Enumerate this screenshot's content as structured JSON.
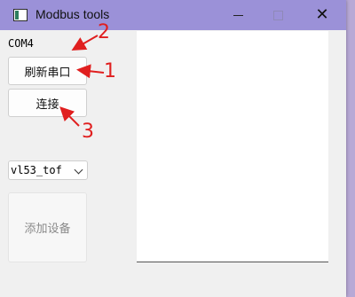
{
  "window": {
    "title": "Modbus tools",
    "controls": {
      "minimize": "minimize-icon",
      "maximize": "maximize-icon",
      "close": "close-icon"
    }
  },
  "sidebar": {
    "port_value": "COM4",
    "refresh_label": "刷新串口",
    "connect_label": "连接",
    "device_select": "vl53_tof",
    "add_device_label": "添加设备"
  },
  "annotations": {
    "one": "1",
    "two": "2",
    "three": "3",
    "color": "#e01f1f"
  }
}
